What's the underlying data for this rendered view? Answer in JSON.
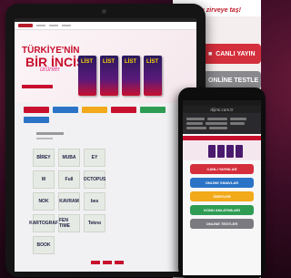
{
  "background_site": {
    "tagline": "başarını zirveye taş!",
    "live_button": "CANLI YAYIN",
    "test_button": "ONLİNE TESTLE"
  },
  "tablet": {
    "hero": {
      "line1": "TÜRKİYE'NİN",
      "line2": "BİR İNCİSİ",
      "line3": "ürünler",
      "book_label": "LİST"
    },
    "publisher_tiles": [
      "BİREY",
      "MUBA",
      "EY",
      "M",
      "Full",
      "OCTOPUS",
      "NOK",
      "KAVRAM",
      "bes",
      "KARTOGRAF",
      "FEN TIME",
      "Tekno",
      "BOOK"
    ]
  },
  "phone": {
    "url": "dijimi.com.tr",
    "buttons": [
      {
        "label": "CANLI YAYINLAR",
        "color": "#d42f3c"
      },
      {
        "label": "ONLİNE SINAVLAR",
        "color": "#2a73c6"
      },
      {
        "label": "ÖDEVLER",
        "color": "#f2a91a"
      },
      {
        "label": "KONU ANLATIMLARI",
        "color": "#2f9c54"
      },
      {
        "label": "ONLİNE TESTLER",
        "color": "#7a7a80"
      }
    ]
  },
  "colors": {
    "brand_red": "#c8102e",
    "background": "#2a0a1c"
  }
}
